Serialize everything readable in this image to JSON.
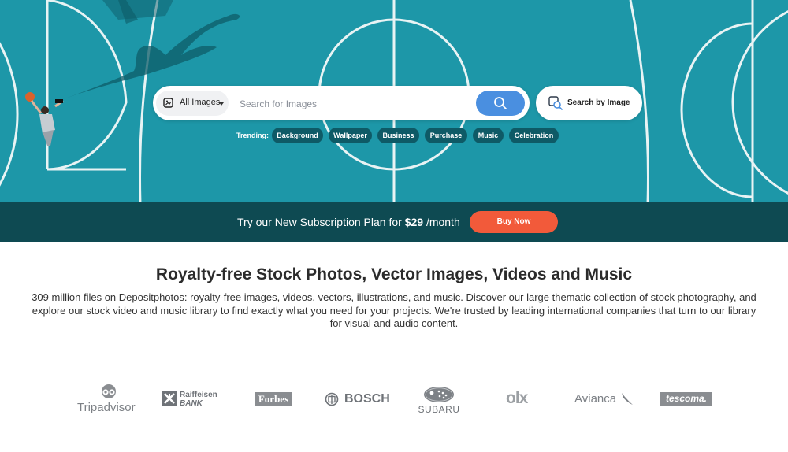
{
  "search": {
    "type_label": "All Images",
    "placeholder": "Search for Images",
    "by_image_label": "Search by Image"
  },
  "trending": {
    "label": "Trending:",
    "chips": [
      "Background",
      "Wallpaper",
      "Business",
      "Purchase",
      "Music",
      "Celebration"
    ]
  },
  "promo": {
    "text_before": "Try our New Subscription Plan for",
    "price": "$29",
    "text_after": "/month",
    "button_label": "Buy Now"
  },
  "content": {
    "title": "Royalty-free Stock Photos, Vector Images, Videos and Music",
    "description": "309 million files on Depositphotos: royalty-free images, videos, vectors, illustrations, and music. Discover our large thematic collection of stock photography, and explore our stock video and music library to find exactly what you need for your projects. We're trusted by leading international companies that turn to our library for visual and audio content."
  },
  "logos": {
    "tripadvisor": "Tripadvisor",
    "raiffeisen_1": "Raiffeisen",
    "raiffeisen_2": "BANK",
    "forbes": "Forbes",
    "bosch": "BOSCH",
    "subaru": "SUBARU",
    "olx": "olx",
    "avianca": "Avianca",
    "tescoma": "tescoma."
  },
  "colors": {
    "hero_bg": "#1d97a8",
    "promo_bg": "#0e4a52",
    "accent_blue": "#4a8fe0",
    "buy_orange": "#f25a3a",
    "chip_bg": "#0e5a66"
  }
}
